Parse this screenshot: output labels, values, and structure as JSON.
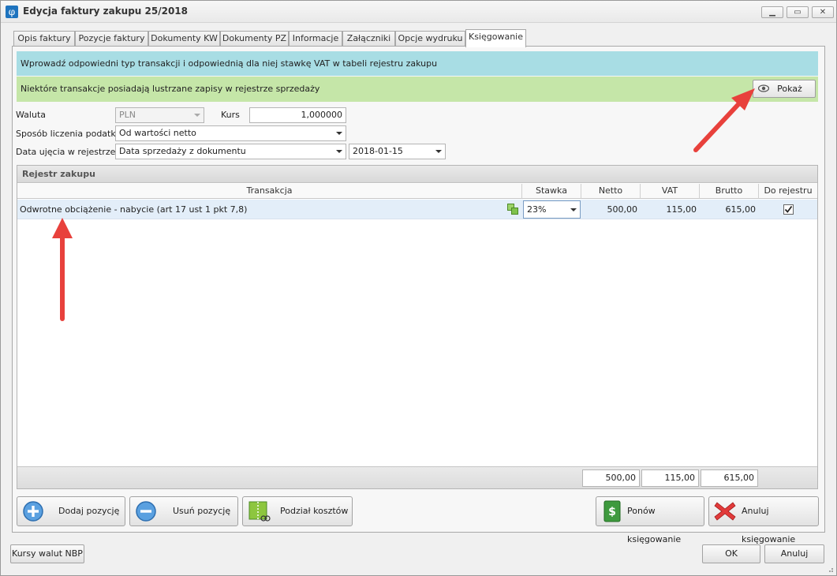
{
  "window": {
    "title": "Edycja faktury zakupu 25/2018",
    "app_icon": "φ",
    "controls": [
      "minimize-icon",
      "maximize-icon",
      "close-icon"
    ]
  },
  "tabs": [
    {
      "label": "Opis faktury",
      "active": false
    },
    {
      "label": "Pozycje faktury",
      "active": false
    },
    {
      "label": "Dokumenty KW",
      "active": false
    },
    {
      "label": "Dokumenty PZ",
      "active": false
    },
    {
      "label": "Informacje",
      "active": false
    },
    {
      "label": "Załączniki",
      "active": false
    },
    {
      "label": "Opcje wydruku",
      "active": false
    },
    {
      "label": "Księgowanie",
      "active": true
    }
  ],
  "info": {
    "blue_text": "Wprowadź odpowiedni typ transakcji i odpowiednią dla niej stawkę VAT w tabeli rejestru zakupu",
    "green_text": "Niektóre transakcje posiadają lustrzane zapisy w rejestrze sprzedaży",
    "show_button": "Pokaż"
  },
  "form": {
    "waluta_label": "Waluta",
    "waluta_value": "PLN",
    "kurs_label": "Kurs",
    "kurs_value": "1,000000",
    "sposob_label": "Sposób liczenia podatku",
    "sposob_value": "Od wartości netto",
    "data_label": "Data ujęcia w rejestrze",
    "data_value": "Data sprzedaży z dokumentu",
    "date_value": "2018-01-15"
  },
  "grid": {
    "title": "Rejestr zakupu",
    "columns": [
      "Transakcja",
      "Stawka",
      "Netto",
      "VAT",
      "Brutto",
      "Do rejestru"
    ],
    "rows": [
      {
        "transakcja": "Odwrotne obciążenie - nabycie (art 17 ust 1 pkt 7,8)",
        "stawka": "23%",
        "netto": "500,00",
        "vat": "115,00",
        "brutto": "615,00",
        "do_rejestru": true
      }
    ],
    "totals": {
      "netto": "500,00",
      "vat": "115,00",
      "brutto": "615,00"
    }
  },
  "actions": {
    "add": "Dodaj pozycję",
    "remove": "Usuń pozycję",
    "split": "Podział kosztów",
    "repost": "Ponów księgowanie",
    "cancel_post": "Anuluj księgowanie"
  },
  "bottom": {
    "nbp": "Kursy walut NBP",
    "ok": "OK",
    "cancel": "Anuluj"
  },
  "colors": {
    "info_blue": "#a8dde4",
    "info_green": "#c5e6a8",
    "row_selected": "#e3eef9",
    "annotation_arrow": "#e8413c"
  }
}
